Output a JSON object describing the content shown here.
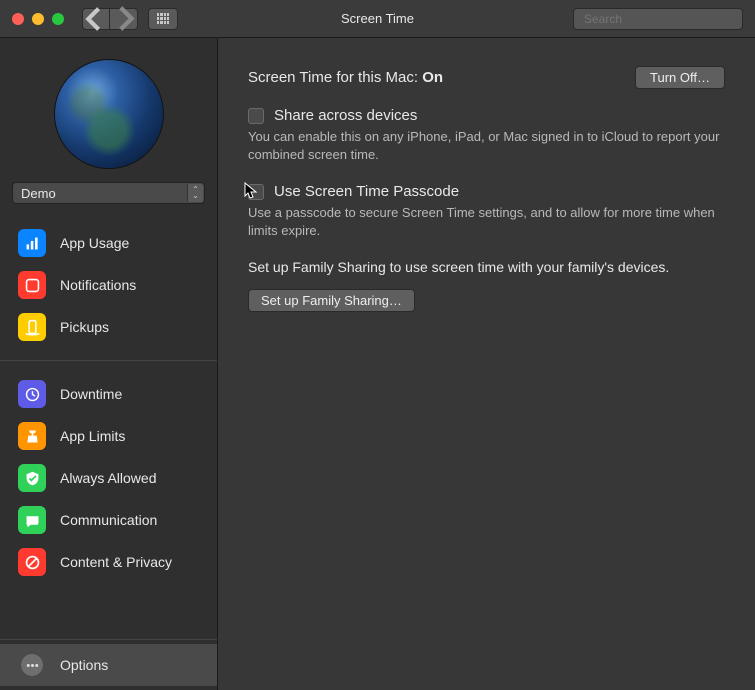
{
  "toolbar": {
    "title": "Screen Time",
    "search_placeholder": "Search"
  },
  "sidebar": {
    "user": "Demo",
    "items_a": [
      {
        "label": "App Usage"
      },
      {
        "label": "Notifications"
      },
      {
        "label": "Pickups"
      }
    ],
    "items_b": [
      {
        "label": "Downtime"
      },
      {
        "label": "App Limits"
      },
      {
        "label": "Always Allowed"
      },
      {
        "label": "Communication"
      },
      {
        "label": "Content & Privacy"
      }
    ],
    "bottom": {
      "label": "Options"
    }
  },
  "content": {
    "header_label": "Screen Time for this Mac: ",
    "header_state": "On",
    "turn_off": "Turn Off…",
    "share_label": "Share across devices",
    "share_desc": "You can enable this on any iPhone, iPad, or Mac signed in to iCloud to report your combined screen time.",
    "passcode_label": "Use Screen Time Passcode",
    "passcode_desc": "Use a passcode to secure Screen Time settings, and to allow for more time when limits expire.",
    "family_text": "Set up Family Sharing to use screen time with your family's devices.",
    "family_btn": "Set up Family Sharing…"
  }
}
